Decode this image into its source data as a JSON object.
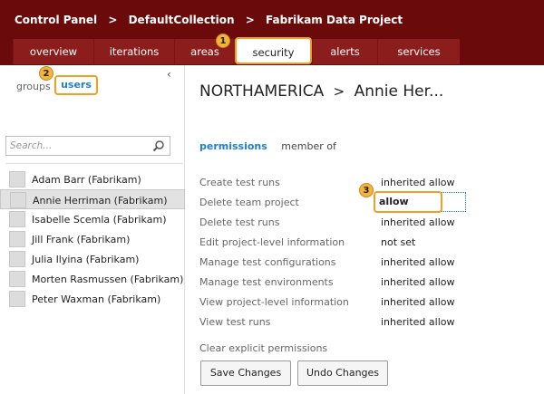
{
  "breadcrumb": [
    "Control Panel",
    "DefaultCollection",
    "Fabrikam Data Project"
  ],
  "breadcrumb_separator": ">",
  "tabs": [
    {
      "label": "overview",
      "active": false
    },
    {
      "label": "iterations",
      "active": false
    },
    {
      "label": "areas",
      "active": false
    },
    {
      "label": "security",
      "active": true
    },
    {
      "label": "alerts",
      "active": false
    },
    {
      "label": "services",
      "active": false
    }
  ],
  "callouts": [
    "1",
    "2",
    "3"
  ],
  "left_panel": {
    "groups_label": "groups",
    "users_label": "users",
    "collapse_glyph": "‹",
    "search_placeholder": "Search...",
    "users": [
      {
        "name": "Adam Barr (Fabrikam)",
        "selected": false
      },
      {
        "name": "Annie Herriman (Fabrikam)",
        "selected": true
      },
      {
        "name": "Isabelle Scemla (Fabrikam)",
        "selected": false
      },
      {
        "name": "Jill Frank (Fabrikam)",
        "selected": false
      },
      {
        "name": "Julia Ilyina (Fabrikam)",
        "selected": false
      },
      {
        "name": "Morten Rasmussen (Fabrikam)",
        "selected": false
      },
      {
        "name": "Peter Waxman (Fabrikam)",
        "selected": false
      }
    ]
  },
  "right_panel": {
    "title_group": "NORTHAMERICA",
    "title_separator": ">",
    "title_user": "Annie Her...",
    "sub_tabs": [
      {
        "label": "permissions",
        "active": true
      },
      {
        "label": "member of",
        "active": false
      }
    ],
    "permissions": [
      {
        "name": "Create test runs",
        "value": "inherited allow"
      },
      {
        "name": "Delete team project",
        "value": "allow",
        "editing": true
      },
      {
        "name": "Delete test runs",
        "value": "inherited allow"
      },
      {
        "name": "Edit project-level information",
        "value": "not set"
      },
      {
        "name": "Manage test configurations",
        "value": "inherited allow"
      },
      {
        "name": "Manage test environments",
        "value": "inherited allow"
      },
      {
        "name": "View project-level information",
        "value": "inherited allow"
      },
      {
        "name": "View test runs",
        "value": "inherited allow"
      }
    ],
    "clear_link": "Clear explicit permissions",
    "save_label": "Save Changes",
    "undo_label": "Undo Changes"
  },
  "colors": {
    "header_bg": "#6b0a0a",
    "tab_bg": "#8c1d1d",
    "highlight": "#f0a020",
    "link": "#1f7fc7",
    "badge": "#f2b43a"
  },
  "icons": {
    "search": "search-icon",
    "avatar": "user-avatar-icon",
    "collapse": "chevron-left-icon"
  }
}
